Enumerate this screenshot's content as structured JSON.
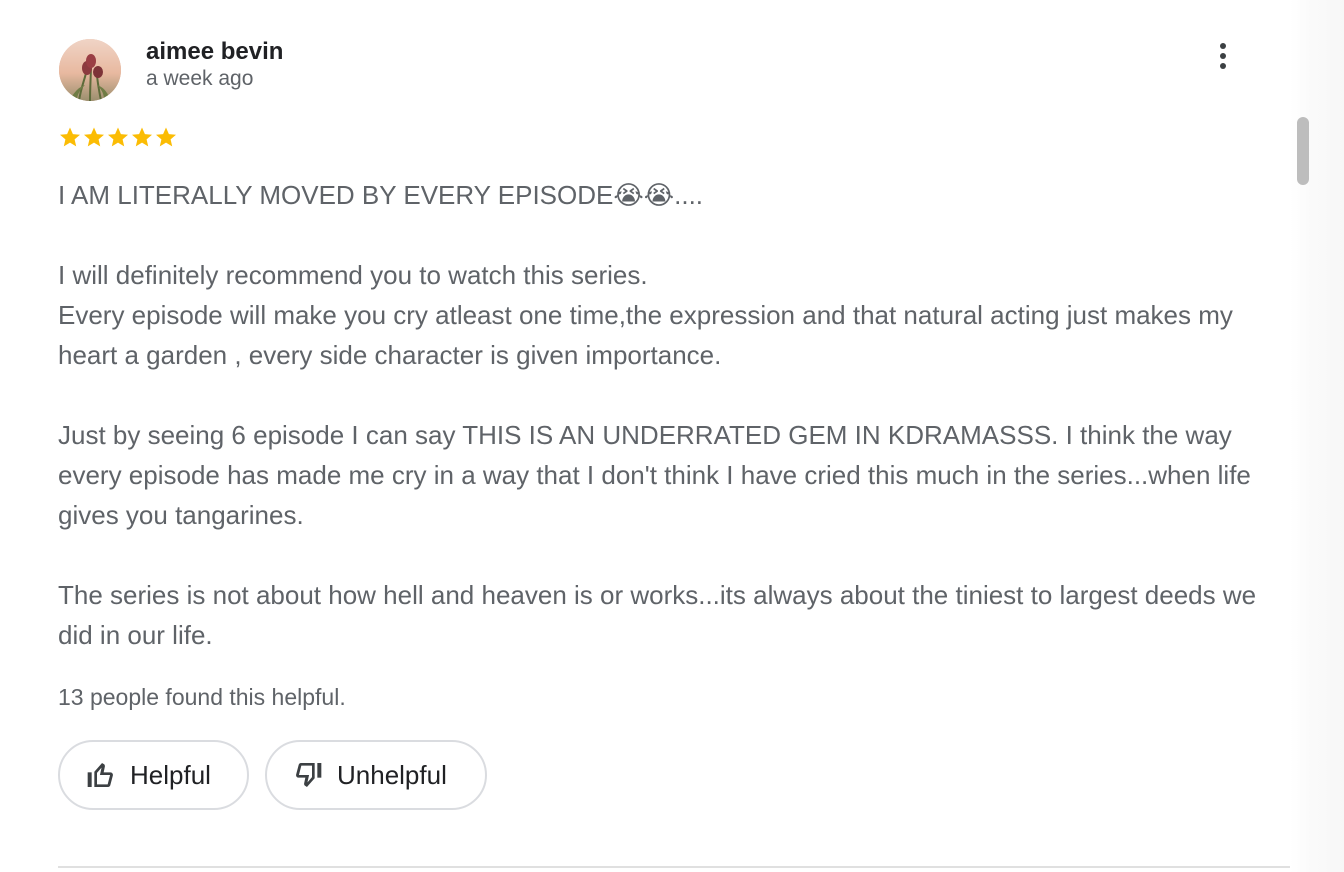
{
  "review": {
    "author": "aimee bevin",
    "date": "a week ago",
    "rating": 5,
    "rating_max": 5,
    "star_color": "#fbbc04",
    "paragraphs": [
      "I AM LITERALLY MOVED BY EVERY EPISODE😭😭....",
      "I will definitely recommend you to watch this series.\nEvery episode will make you cry atleast one time,the expression and that natural acting just makes my heart a garden , every side character is given importance.",
      "Just by seeing 6 episode I can say THIS IS AN UNDERRATED GEM IN KDRAMASSS. I think the way every episode has made me cry in a way that I don't think I have cried this much in the series...when life gives you tangarines.",
      "The series is not about how hell and heaven is or works...its always about the tiniest to largest deeds we did in our life."
    ],
    "helpful_count_text": "13 people found this helpful.",
    "actions": {
      "helpful_label": "Helpful",
      "unhelpful_label": "Unhelpful"
    },
    "icons": {
      "more": "more-vert-icon",
      "helpful": "thumb-up-icon",
      "unhelpful": "thumb-down-icon",
      "star": "star-icon"
    }
  }
}
